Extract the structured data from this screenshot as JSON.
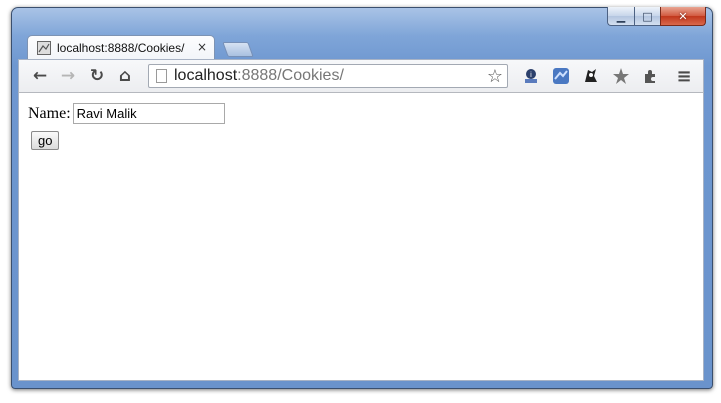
{
  "window": {
    "controls": {
      "minimize": "▁",
      "maximize": "□",
      "close": "✕"
    }
  },
  "tab": {
    "title": "localhost:8888/Cookies/",
    "close": "×",
    "favicon": "page-favicon"
  },
  "toolbar": {
    "back": "←",
    "forward": "→",
    "reload": "↻",
    "home": "⌂",
    "url_host": "localhost",
    "url_rest": ":8888/Cookies/",
    "star": "☆",
    "menu": "≡",
    "extensions": [
      "extension-icon-1",
      "extension-icon-2",
      "extension-icon-3",
      "extension-icon-4",
      "puzzle-icon"
    ]
  },
  "page": {
    "name_label": "Name:",
    "name_value": "Ravi Malik",
    "go_label": "go"
  }
}
